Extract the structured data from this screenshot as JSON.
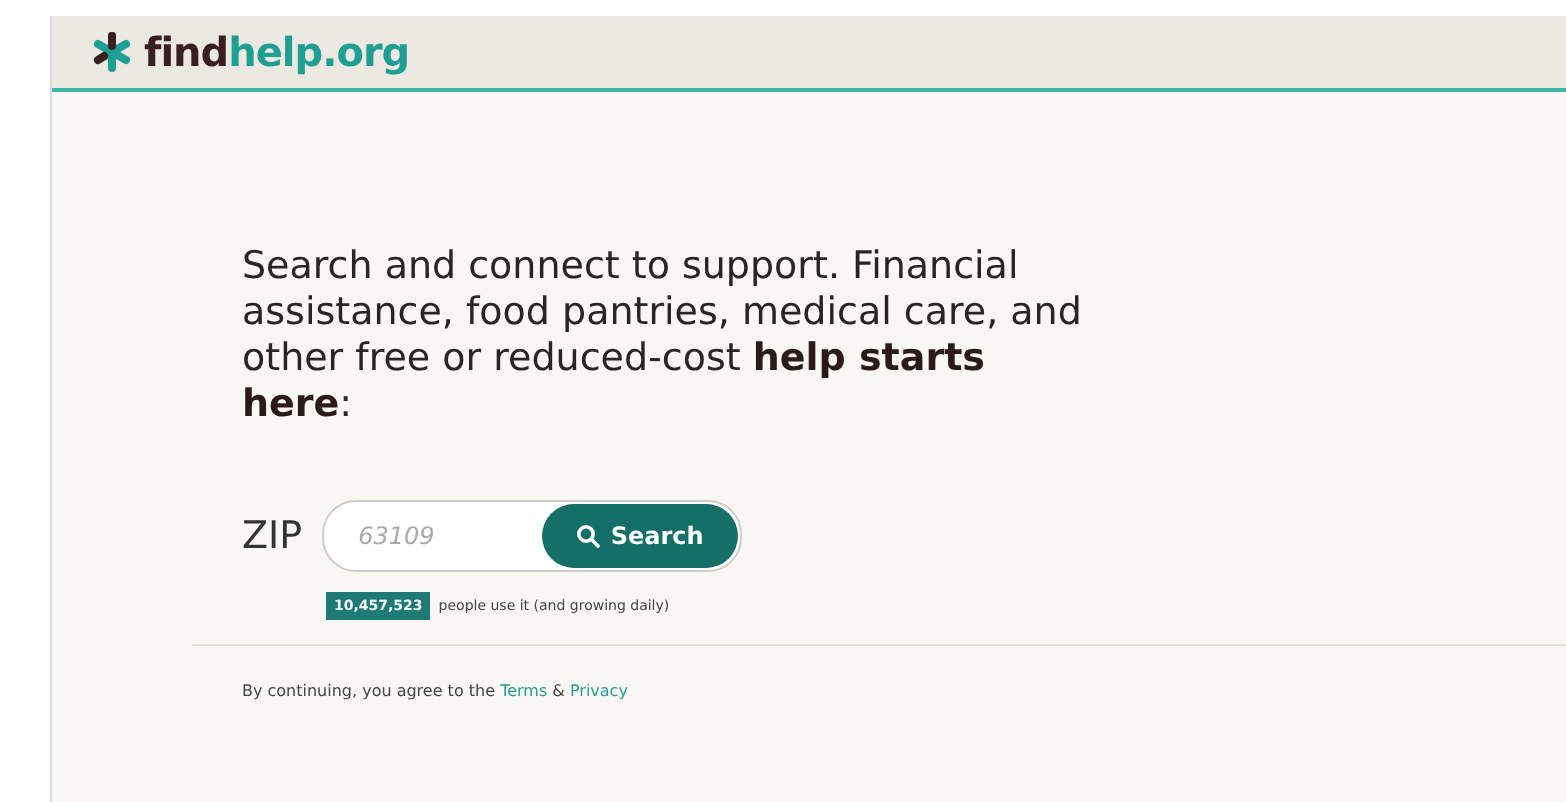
{
  "header": {
    "logo": {
      "dark": "find",
      "accent": "help.org"
    }
  },
  "hero": {
    "headline": "Search and connect to support. Financial assistance, food pantries, medical care, and other free or reduced-cost **help starts here**:"
  },
  "search": {
    "label": "ZIP",
    "placeholder": "63109",
    "button": "Search"
  },
  "stats": {
    "count": "10,457,523",
    "text": "people use it (and growing daily)"
  },
  "footer": {
    "prefix": "By continuing, you agree to the",
    "terms": "Terms",
    "amp": "&",
    "privacy": "Privacy"
  }
}
